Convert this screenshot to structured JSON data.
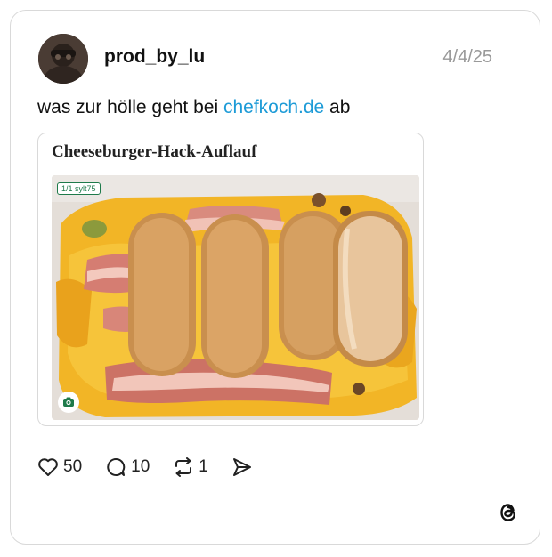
{
  "post": {
    "username": "prod_by_lu",
    "date": "4/4/25",
    "text_before": "was zur hölle geht bei ",
    "link_text": "chefkoch.de",
    "text_after": " ab"
  },
  "embed": {
    "title": "Cheeseburger-Hack-Auflauf",
    "photo_badge": "1/1 sylt75"
  },
  "actions": {
    "likes": "50",
    "replies": "10",
    "reposts": "1"
  },
  "icons": {
    "like": "heart-icon",
    "reply": "comment-icon",
    "repost": "repost-icon",
    "share": "send-icon",
    "brand": "threads-logo-icon",
    "camera": "camera-icon"
  },
  "colors": {
    "link": "#1d9bd7",
    "badge": "#1e7a4a"
  }
}
